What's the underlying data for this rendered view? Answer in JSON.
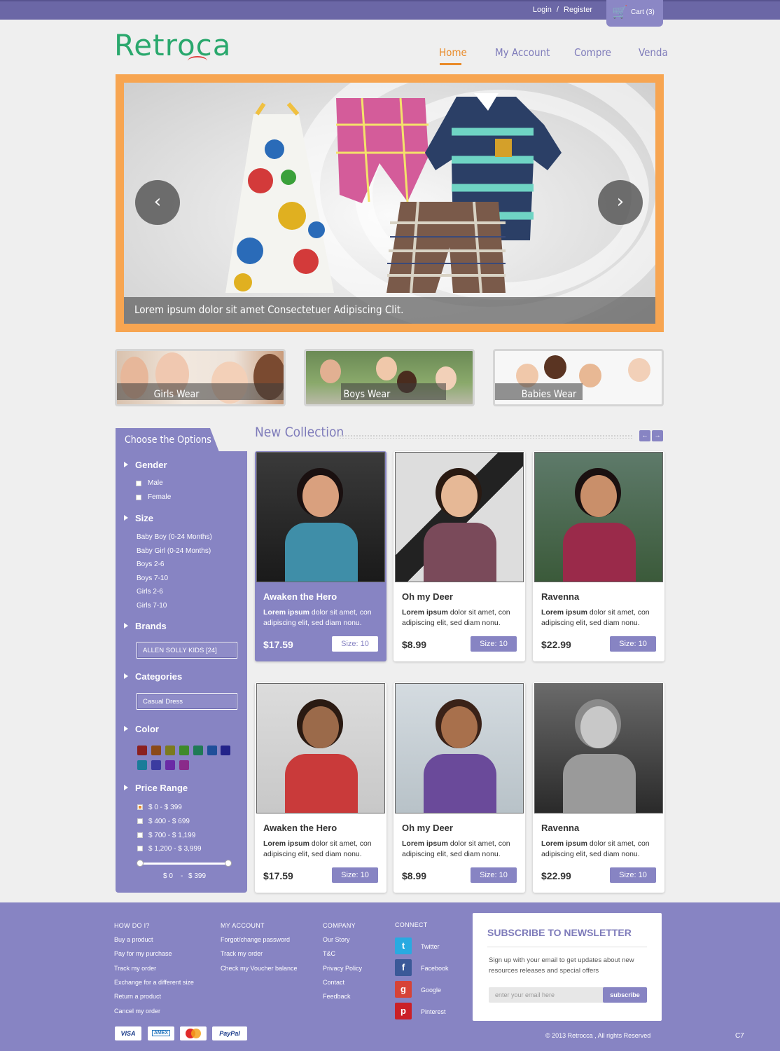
{
  "header": {
    "login": "Login",
    "separator": "/",
    "register": "Register",
    "cart": "Cart (3)",
    "logo": "Retroca",
    "nav": [
      {
        "label": "Home",
        "active": true
      },
      {
        "label": "My Account"
      },
      {
        "label": "Compre"
      },
      {
        "label": "Venda"
      }
    ]
  },
  "slider": {
    "caption": "Lorem ipsum dolor sit amet Consectetuer Adipiscing Clit.",
    "prev": "‹",
    "next": "›"
  },
  "categories": [
    {
      "label": "Girls Wear"
    },
    {
      "label": "Boys Wear"
    },
    {
      "label": "Babies Wear"
    }
  ],
  "sidebar": {
    "title": "Choose the Options",
    "gender": {
      "title": "Gender",
      "options": [
        "Male",
        "Female"
      ]
    },
    "size": {
      "title": "Size",
      "options": [
        "Baby Boy (0-24 Months)",
        "Baby Girl (0-24 Months)",
        "Boys 2-6",
        "Boys 7-10",
        "Girls 2-6",
        "Girls 7-10"
      ]
    },
    "brands": {
      "title": "Brands",
      "selected": "ALLEN SOLLY KIDS [24]"
    },
    "categories": {
      "title": "Categories",
      "selected": "Casual Dress"
    },
    "color": {
      "title": "Color",
      "swatches": [
        "#8b2020",
        "#8b4a18",
        "#7b7a1e",
        "#3e8a2a",
        "#1f7a55",
        "#1f4f9a",
        "#23238a",
        "#1a7c99",
        "#3b3ba0",
        "#6a2aa6",
        "#8a2a8a"
      ]
    },
    "price": {
      "title": "Price Range",
      "options": [
        "$ 0 - $ 399",
        "$ 400 - $ 699",
        "$ 700 - $ 1,199",
        "$ 1,200 - $ 3,999"
      ],
      "selected_index": 0,
      "range_min": "$ 0",
      "range_sep": "-",
      "range_max": "$ 399"
    }
  },
  "collection": {
    "title": "New Collection",
    "prev": "←",
    "next": "→",
    "products": [
      {
        "name": "Awaken the Hero",
        "desc_bold": "Lorem ipsum",
        "desc": " dolor sit amet, con adipiscing elit, sed diam nonu.",
        "price": "$17.59",
        "size": "Size: 10",
        "highlighted": true
      },
      {
        "name": "Oh my Deer",
        "desc_bold": "Lorem ipsum",
        "desc": " dolor sit amet, con adipiscing elit, sed diam nonu.",
        "price": "$8.99",
        "size": "Size: 10"
      },
      {
        "name": "Ravenna",
        "desc_bold": "Lorem ipsum",
        "desc": " dolor sit amet, con adipiscing elit, sed diam nonu.",
        "price": "$22.99",
        "size": "Size: 10"
      },
      {
        "name": "Awaken the Hero",
        "desc_bold": "Lorem ipsum",
        "desc": " dolor sit amet, con adipiscing elit, sed diam nonu.",
        "price": "$17.59",
        "size": "Size: 10"
      },
      {
        "name": "Oh my Deer",
        "desc_bold": "Lorem ipsum",
        "desc": " dolor sit amet, con adipiscing elit, sed diam nonu.",
        "price": "$8.99",
        "size": "Size: 10"
      },
      {
        "name": "Ravenna",
        "desc_bold": "Lorem ipsum",
        "desc": " dolor sit amet, con adipiscing elit, sed diam nonu.",
        "price": "$22.99",
        "size": "Size: 10"
      }
    ]
  },
  "footer": {
    "how": {
      "title": "HOW DO I?",
      "links": [
        "Buy a  product",
        "Pay for my purchase",
        "Track my order",
        "Exchange for a different size",
        "Return a product",
        "Cancel my order"
      ]
    },
    "account": {
      "title": "MY ACCOUNT",
      "links": [
        "Forgot/change password",
        "Track my order",
        "Check my Voucher balance"
      ]
    },
    "company": {
      "title": "COMPANY",
      "links": [
        "Our Story",
        "T&C",
        "Privacy Policy",
        "Contact",
        "Feedback"
      ]
    },
    "connect": {
      "title": "CONNECT",
      "items": [
        {
          "name": "Twitter",
          "icon": "twitter-icon",
          "glyph": "t",
          "color": "#29aae1"
        },
        {
          "name": "Facebook",
          "icon": "facebook-icon",
          "glyph": "f",
          "color": "#3b5998"
        },
        {
          "name": "Google",
          "icon": "google-icon",
          "glyph": "g",
          "color": "#d64337"
        },
        {
          "name": "Pinterest",
          "icon": "pinterest-icon",
          "glyph": "p",
          "color": "#cb2027"
        }
      ]
    },
    "newsletter": {
      "title": "SUBSCRIBE TO NEWSLETTER",
      "desc": "Sign up with your email to get updates about new resources releases and special offers",
      "placeholder": "enter your email here",
      "button": "subscribe"
    },
    "payments": [
      "VISA",
      "AMEX",
      "MC",
      "PayPal"
    ],
    "copyright": "© 2013  Retrocca , All rights Reserved",
    "code": "C7"
  }
}
